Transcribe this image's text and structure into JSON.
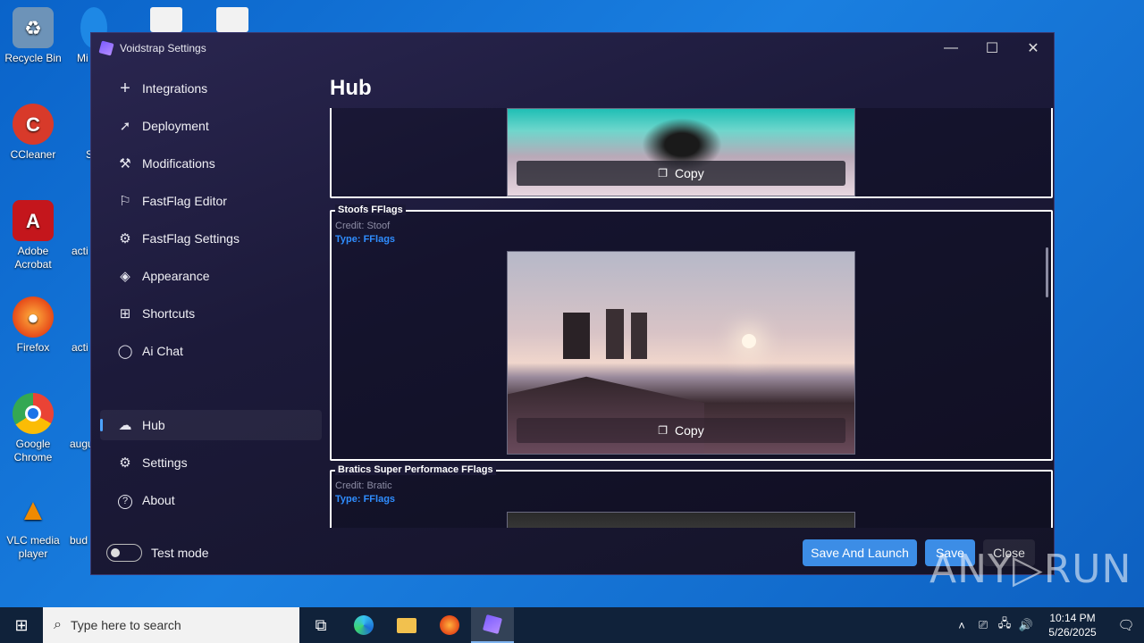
{
  "desktop": {
    "icons": [
      {
        "label": "Recycle Bin",
        "icon": "recycle-bin-icon",
        "color": "#8fb5d8"
      },
      {
        "label": "CCleaner",
        "icon": "ccleaner-icon",
        "color": "#d83a2a"
      },
      {
        "label": "Adobe Acrobat",
        "icon": "acrobat-icon",
        "color": "#c4161c"
      },
      {
        "label": "Firefox",
        "icon": "firefox-icon",
        "color": "#ff7a1a"
      },
      {
        "label": "Google Chrome",
        "icon": "chrome-icon",
        "color": "#1a73e8"
      },
      {
        "label": "VLC media player",
        "icon": "vlc-icon",
        "color": "#f08a00"
      }
    ],
    "partial_labels": [
      "Mi",
      "S",
      "acti",
      "acti",
      "augu",
      "bud"
    ]
  },
  "window": {
    "title": "Voidstrap Settings",
    "controls": {
      "minimize": "—",
      "maximize": "☐",
      "close": "✕"
    }
  },
  "sidebar": {
    "items": [
      {
        "label": "Integrations",
        "icon": "plus-icon",
        "glyph": "+"
      },
      {
        "label": "Deployment",
        "icon": "rocket-icon",
        "glyph": "➚"
      },
      {
        "label": "Modifications",
        "icon": "wrench-icon",
        "glyph": "⚒"
      },
      {
        "label": "FastFlag Editor",
        "icon": "flag-icon",
        "glyph": "⚐"
      },
      {
        "label": "FastFlag Settings",
        "icon": "gear-icon",
        "glyph": "⚙"
      },
      {
        "label": "Appearance",
        "icon": "paint-bucket-icon",
        "glyph": "◈"
      },
      {
        "label": "Shortcuts",
        "icon": "grid-icon",
        "glyph": "⊞"
      },
      {
        "label": "Ai Chat",
        "icon": "chat-icon",
        "glyph": "💬"
      }
    ],
    "bottom_items": [
      {
        "label": "Hub",
        "icon": "cloud-icon",
        "glyph": "☁",
        "active": true
      },
      {
        "label": "Settings",
        "icon": "gear-icon",
        "glyph": "⚙"
      },
      {
        "label": "About",
        "icon": "help-icon",
        "glyph": "?"
      }
    ],
    "test_mode_label": "Test mode",
    "test_mode_on": false
  },
  "main": {
    "title": "Hub",
    "copy_label": "Copy",
    "cards": [
      {
        "title": "",
        "credit": "",
        "type": ""
      },
      {
        "title": "Stoofs FFlags",
        "credit": "Credit: Stoof",
        "type": "Type: FFlags"
      },
      {
        "title": "Bratics Super Performace FFlags",
        "credit": "Credit: Bratic",
        "type": "Type: FFlags"
      }
    ]
  },
  "footer": {
    "save_and_launch": "Save And Launch",
    "save": "Save",
    "close": "Close"
  },
  "watermark": "ANY▷RUN",
  "taskbar": {
    "search_placeholder": "Type here to search",
    "time": "10:14 PM",
    "date": "5/26/2025"
  }
}
